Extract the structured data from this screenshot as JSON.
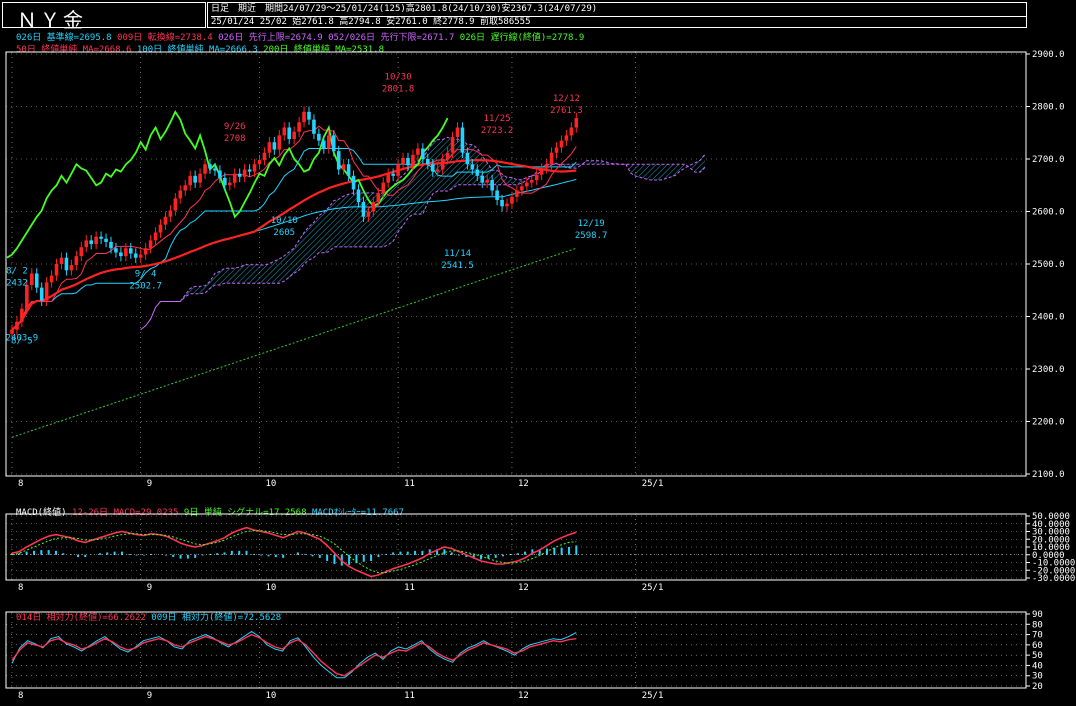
{
  "header": {
    "title": "ＮＹ金",
    "info_line1": "日足　期近　期間24/07/29～25/01/24(125)高2801.8(24/10/30)安2367.3(24/07/29)",
    "info_line2": "25/01/24 25/02 始2761.8 高2794.8 安2761.0 終2778.9 前取586555"
  },
  "legends": {
    "main_row1": [
      {
        "text": "026日 基準線=2695.8",
        "color": "#22d4ff"
      },
      {
        "text": "009日 転換線=2738.4",
        "color": "#ff3355"
      },
      {
        "text": "026日 先行上限=2674.9",
        "color": "#cc66ff"
      },
      {
        "text": "052/026日 先行下限=2671.7",
        "color": "#cc66ff"
      },
      {
        "text": "026日 遅行線(終値)=2778.9",
        "color": "#44ff22"
      }
    ],
    "main_row2": [
      {
        "text": "50日 終値単純 MA=2668.6",
        "color": "#ff3355"
      },
      {
        "text": "100日 終値単純 MA=2666.3",
        "color": "#22d4ff"
      },
      {
        "text": "200日 終値単純 MA=2531.8",
        "color": "#44ff22"
      }
    ],
    "macd": [
      {
        "text": "MACD(終値)",
        "color": "#ffffff"
      },
      {
        "text": "12-26日 MACD=29.0235",
        "color": "#ff3355"
      },
      {
        "text": "9日 単純 シグナル=17.2568",
        "color": "#44ff22"
      },
      {
        "text": "MACDｵｼﾚｰﾀｰ=11.7667",
        "color": "#22d4ff"
      }
    ],
    "rsi": [
      {
        "text": "014日 相対力(終値)=66.2622",
        "color": "#ff3355"
      },
      {
        "text": "009日 相対力(終値)=72.5628",
        "color": "#22d4ff"
      }
    ]
  },
  "colors": {
    "up": "#ff2222",
    "down": "#22d4ff",
    "grid": "#ffffff",
    "ma50": "#ff2222",
    "ma100": "#22d4ff",
    "ma200": "#33cc33",
    "kijun": "#22d4ff",
    "tenkan": "#ff3355",
    "chikou": "#44ff22",
    "cloud": "#cc66ff",
    "cloud_fill": "#22d4ff"
  },
  "chart_data": [
    {
      "type": "candlestick",
      "panel": "price",
      "ylim": [
        2100,
        2900
      ],
      "y_ticks": [
        2100,
        2200,
        2300,
        2400,
        2500,
        2600,
        2700,
        2800,
        2900
      ],
      "y_tick_labels": [
        "2100.0",
        "2200.0",
        "2300.0",
        "2400.0",
        "2500.0",
        "2600.0",
        "2700.0",
        "2800.0",
        "2900.0"
      ],
      "x_range": [
        0,
        170
      ],
      "x_ticks": [
        {
          "label": "8",
          "i": 0
        },
        {
          "label": "9",
          "i": 26
        },
        {
          "label": "10",
          "i": 50
        },
        {
          "label": "11",
          "i": 78
        },
        {
          "label": "12",
          "i": 101
        },
        {
          "label": "25/1",
          "i": 126
        }
      ],
      "grid": true,
      "closes": [
        2375,
        2390,
        2415,
        2460,
        2482,
        2455,
        2430,
        2465,
        2478,
        2500,
        2512,
        2488,
        2498,
        2515,
        2532,
        2545,
        2538,
        2552,
        2548,
        2542,
        2530,
        2522,
        2515,
        2530,
        2520,
        2512,
        2518,
        2530,
        2545,
        2560,
        2575,
        2590,
        2602,
        2625,
        2640,
        2650,
        2668,
        2655,
        2672,
        2690,
        2682,
        2678,
        2664,
        2650,
        2655,
        2672,
        2666,
        2680,
        2676,
        2690,
        2698,
        2712,
        2732,
        2718,
        2745,
        2760,
        2738,
        2752,
        2770,
        2790,
        2775,
        2748,
        2735,
        2720,
        2745,
        2715,
        2680,
        2690,
        2668,
        2642,
        2618,
        2590,
        2600,
        2618,
        2635,
        2655,
        2672,
        2668,
        2690,
        2702,
        2688,
        2708,
        2720,
        2700,
        2690,
        2676,
        2680,
        2700,
        2712,
        2742,
        2760,
        2712,
        2690,
        2680,
        2668,
        2655,
        2660,
        2640,
        2622,
        2610,
        2615,
        2628,
        2640,
        2648,
        2655,
        2660,
        2670,
        2682,
        2690,
        2712,
        2722,
        2735,
        2745,
        2760,
        2778
      ],
      "annotations": [
        {
          "label": "8/ 5",
          "i": 2,
          "value": 2375
        },
        {
          "label": "2403.9",
          "i": 2,
          "value": 2403.9
        },
        {
          "label": "8/ 2",
          "i": 1,
          "value": 2432
        },
        {
          "label": "2432",
          "i": 1,
          "value": 2432
        },
        {
          "label": "9/ 4",
          "i": 27,
          "value": 2502.7
        },
        {
          "label": "2502.7",
          "i": 27,
          "value": 2502.7
        },
        {
          "label": "9/26",
          "i": 45,
          "value": 2708
        },
        {
          "label": "2708",
          "i": 45,
          "value": 2708
        },
        {
          "label": "10/10",
          "i": 55,
          "value": 2605
        },
        {
          "label": "2605",
          "i": 55,
          "value": 2605
        },
        {
          "label": "10/30",
          "i": 78,
          "value": 2801.8
        },
        {
          "label": "2801.8",
          "i": 78,
          "value": 2801.8
        },
        {
          "label": "11/14",
          "i": 90,
          "value": 2541.5
        },
        {
          "label": "2541.5",
          "i": 90,
          "value": 2541.5
        },
        {
          "label": "11/25",
          "i": 98,
          "value": 2723.2
        },
        {
          "label": "2723.2",
          "i": 98,
          "value": 2723.2
        },
        {
          "label": "12/12",
          "i": 112,
          "value": 2761.3
        },
        {
          "label": "2761.3",
          "i": 112,
          "value": 2761.3
        },
        {
          "label": "12/19",
          "i": 117,
          "value": 2598.7
        },
        {
          "label": "2598.7",
          "i": 117,
          "value": 2598.7
        }
      ]
    },
    {
      "type": "line",
      "panel": "macd",
      "ylim": [
        -30,
        50
      ],
      "y_ticks": [
        -30,
        -20,
        -10,
        0,
        10,
        20,
        30,
        40,
        50
      ],
      "y_tick_labels": [
        "-30.0000",
        "-20.0000",
        "-10.0000",
        "0.0000",
        "10.0000",
        "20.0000",
        "30.0000",
        "40.0000",
        "50.0000"
      ],
      "x_ticks": [
        {
          "label": "8",
          "i": 0
        },
        {
          "label": "9",
          "i": 26
        },
        {
          "label": "10",
          "i": 50
        },
        {
          "label": "11",
          "i": 78
        },
        {
          "label": "12",
          "i": 101
        },
        {
          "label": "25/1",
          "i": 126
        }
      ],
      "series": [
        {
          "name": "MACD",
          "values": [
            2,
            4,
            10,
            15,
            20,
            24,
            26,
            24,
            22,
            18,
            16,
            19,
            22,
            25,
            28,
            30,
            28,
            26,
            25,
            27,
            26,
            24,
            20,
            15,
            12,
            10,
            12,
            15,
            18,
            22,
            28,
            32,
            35,
            32,
            30,
            28,
            25,
            22,
            26,
            30,
            28,
            24,
            20,
            12,
            2,
            -8,
            -15,
            -20,
            -24,
            -28,
            -26,
            -22,
            -18,
            -15,
            -12,
            -8,
            -4,
            2,
            6,
            10,
            8,
            4,
            0,
            -4,
            -8,
            -10,
            -12,
            -12,
            -10,
            -8,
            -4,
            2,
            6,
            12,
            18,
            22,
            26,
            29
          ]
        },
        {
          "name": "シグナル",
          "values": [
            0,
            2,
            6,
            10,
            14,
            18,
            21,
            22,
            22,
            21,
            19,
            19,
            20,
            22,
            24,
            26,
            27,
            27,
            26,
            26,
            26,
            25,
            23,
            20,
            17,
            14,
            13,
            14,
            16,
            19,
            23,
            27,
            30,
            31,
            31,
            30,
            28,
            26,
            26,
            27,
            27,
            26,
            24,
            20,
            14,
            6,
            -2,
            -9,
            -15,
            -20,
            -23,
            -23,
            -21,
            -19,
            -16,
            -13,
            -9,
            -5,
            -1,
            3,
            5,
            5,
            3,
            1,
            -2,
            -5,
            -8,
            -10,
            -11,
            -10,
            -8,
            -5,
            -1,
            4,
            9,
            13,
            16,
            17
          ]
        }
      ]
    },
    {
      "type": "line",
      "panel": "rsi",
      "ylim": [
        20,
        90
      ],
      "y_ticks": [
        20,
        30,
        40,
        50,
        60,
        70,
        80,
        90
      ],
      "y_tick_labels": [
        "20",
        "30",
        "40",
        "50",
        "60",
        "70",
        "80",
        "90"
      ],
      "x_ticks": [
        {
          "label": "8",
          "i": 0
        },
        {
          "label": "9",
          "i": 26
        },
        {
          "label": "10",
          "i": 50
        },
        {
          "label": "11",
          "i": 78
        },
        {
          "label": "12",
          "i": 101
        },
        {
          "label": "25/1",
          "i": 126
        }
      ],
      "series": [
        {
          "name": "014日",
          "values": [
            45,
            55,
            62,
            60,
            58,
            64,
            66,
            62,
            60,
            56,
            58,
            62,
            66,
            63,
            58,
            55,
            57,
            62,
            64,
            66,
            64,
            60,
            58,
            62,
            65,
            68,
            66,
            63,
            60,
            62,
            66,
            70,
            67,
            62,
            58,
            56,
            62,
            65,
            60,
            52,
            44,
            38,
            32,
            30,
            35,
            40,
            45,
            50,
            48,
            52,
            55,
            54,
            58,
            62,
            58,
            52,
            48,
            45,
            50,
            55,
            58,
            62,
            60,
            58,
            56,
            52,
            54,
            58,
            60,
            62,
            64,
            63,
            65,
            66
          ]
        },
        {
          "name": "009日",
          "values": [
            42,
            57,
            64,
            61,
            57,
            66,
            68,
            61,
            58,
            54,
            59,
            64,
            68,
            62,
            56,
            53,
            58,
            64,
            66,
            68,
            64,
            58,
            56,
            64,
            67,
            70,
            67,
            62,
            58,
            63,
            68,
            73,
            68,
            60,
            56,
            54,
            64,
            67,
            58,
            48,
            40,
            34,
            28,
            28,
            34,
            42,
            48,
            52,
            46,
            54,
            58,
            56,
            60,
            64,
            56,
            50,
            46,
            43,
            52,
            57,
            60,
            64,
            60,
            57,
            54,
            50,
            56,
            60,
            62,
            64,
            66,
            65,
            68,
            72
          ]
        }
      ]
    }
  ]
}
